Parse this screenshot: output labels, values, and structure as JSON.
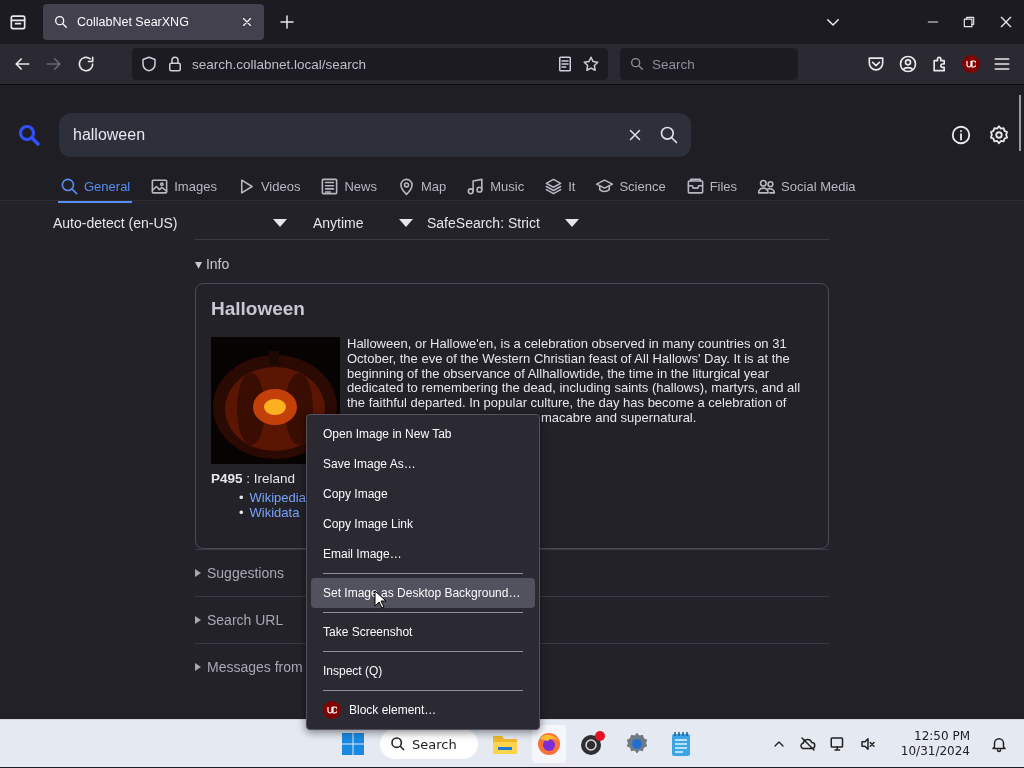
{
  "browser": {
    "tab_title": "CollabNet SearXNG",
    "url": "search.collabnet.local/search",
    "search_placeholder": "Search"
  },
  "search": {
    "value": "halloween"
  },
  "categories": [
    {
      "label": "General",
      "selected": true
    },
    {
      "label": "Images",
      "selected": false
    },
    {
      "label": "Videos",
      "selected": false
    },
    {
      "label": "News",
      "selected": false
    },
    {
      "label": "Map",
      "selected": false
    },
    {
      "label": "Music",
      "selected": false
    },
    {
      "label": "It",
      "selected": false
    },
    {
      "label": "Science",
      "selected": false
    },
    {
      "label": "Files",
      "selected": false
    },
    {
      "label": "Social Media",
      "selected": false
    }
  ],
  "filters": [
    "Auto-detect (en-US)",
    "Anytime",
    "SafeSearch: Strict"
  ],
  "info": {
    "toggle": "▾ Info",
    "title": "Halloween",
    "description": "Halloween, or Hallowe'en, is a celebration observed in many countries on 31 October, the eve of the Western Christian feast of All Hallows' Day. It is at the beginning of the observance of Allhallowtide, the time in the liturgical year dedicated to remembering the dead, including saints (hallows), martyrs, and all the faithful departed. In popular culture, the day has become a celebration of",
    "description_tail": "macabre and supernatural.",
    "attribute": "**P495** : Ireland",
    "links": [
      {
        "bullet": "•",
        "label": "Wikipedia"
      },
      {
        "bullet": "•",
        "label": "Wikidata"
      }
    ]
  },
  "sections": [
    "Suggestions",
    "Search URL",
    "Messages from"
  ],
  "context_menu": {
    "groups": [
      [
        {
          "label": "Open Image in New Tab",
          "selected": false
        },
        {
          "label": "Save Image As…",
          "selected": false
        },
        {
          "label": "Copy Image",
          "selected": false
        },
        {
          "label": "Copy Image Link",
          "selected": false
        },
        {
          "label": "Email Image…",
          "selected": false
        }
      ],
      [
        {
          "label": "Set Image as Desktop Background…",
          "selected": true
        }
      ],
      [
        {
          "label": "Take Screenshot",
          "selected": false
        }
      ],
      [
        {
          "label": "Inspect (Q)",
          "selected": false
        }
      ],
      [
        {
          "label": "Block element…",
          "selected": false
        }
      ]
    ]
  },
  "taskbar": {
    "search_label": "Search",
    "time": "12:50 PM",
    "date": "10/31/2024"
  }
}
